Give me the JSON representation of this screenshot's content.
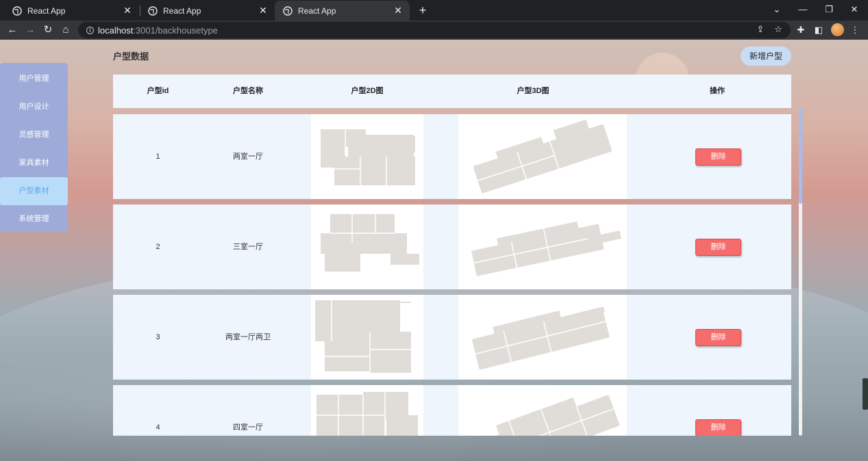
{
  "browser": {
    "tabs": [
      {
        "title": "React App"
      },
      {
        "title": "React App"
      },
      {
        "title": "React App"
      }
    ],
    "url_host": "localhost",
    "url_path": ":3001/backhousetype"
  },
  "sidebar": {
    "items": [
      {
        "label": "用户管理"
      },
      {
        "label": "用户设计"
      },
      {
        "label": "灵感管理"
      },
      {
        "label": "家具素材"
      },
      {
        "label": "户型素材"
      },
      {
        "label": "系统管理"
      }
    ],
    "active_index": 4
  },
  "header": {
    "title": "户型数据",
    "add_button": "新增户型"
  },
  "table": {
    "columns": [
      "户型id",
      "户型名称",
      "户型2D图",
      "户型3D图",
      "操作"
    ],
    "rows": [
      {
        "id": "1",
        "name": "两室一厅",
        "action": "删除"
      },
      {
        "id": "2",
        "name": "三室一厅",
        "action": "删除"
      },
      {
        "id": "3",
        "name": "两室一厅两卫",
        "action": "删除"
      },
      {
        "id": "4",
        "name": "四室一厅",
        "action": "删除"
      }
    ]
  },
  "colors": {
    "accent": "#5aa8ec",
    "sidebar": "#9eaad8",
    "danger": "#f56c6c",
    "table_bg": "#eef5fc",
    "floorplan": "#e0ddd9"
  }
}
